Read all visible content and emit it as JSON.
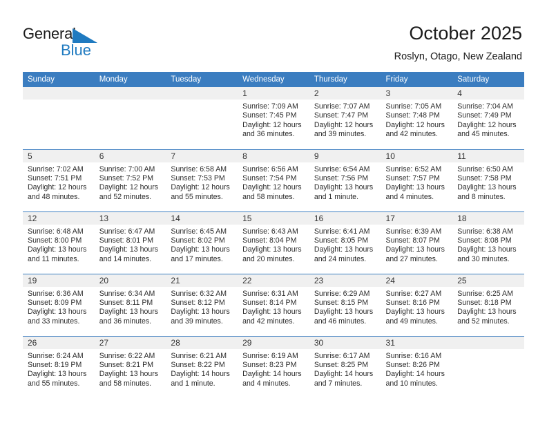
{
  "brand": {
    "name_part1": "General",
    "name_part2": "Blue",
    "accent_color": "#1f7ac0"
  },
  "header": {
    "title": "October 2025",
    "subtitle": "Roslyn, Otago, New Zealand"
  },
  "calendar": {
    "header_color": "#3b7dc0",
    "daynum_band_color": "#f0f0f0",
    "weekday_headers": [
      "Sunday",
      "Monday",
      "Tuesday",
      "Wednesday",
      "Thursday",
      "Friday",
      "Saturday"
    ],
    "labels": {
      "sunrise": "Sunrise:",
      "sunset": "Sunset:",
      "daylight": "Daylight:"
    },
    "weeks": [
      [
        {
          "day": "",
          "empty": true
        },
        {
          "day": "",
          "empty": true
        },
        {
          "day": "",
          "empty": true
        },
        {
          "day": "1",
          "sunrise": "Sunrise: 7:09 AM",
          "sunset": "Sunset: 7:45 PM",
          "daylight": "Daylight: 12 hours and 36 minutes."
        },
        {
          "day": "2",
          "sunrise": "Sunrise: 7:07 AM",
          "sunset": "Sunset: 7:47 PM",
          "daylight": "Daylight: 12 hours and 39 minutes."
        },
        {
          "day": "3",
          "sunrise": "Sunrise: 7:05 AM",
          "sunset": "Sunset: 7:48 PM",
          "daylight": "Daylight: 12 hours and 42 minutes."
        },
        {
          "day": "4",
          "sunrise": "Sunrise: 7:04 AM",
          "sunset": "Sunset: 7:49 PM",
          "daylight": "Daylight: 12 hours and 45 minutes."
        }
      ],
      [
        {
          "day": "5",
          "sunrise": "Sunrise: 7:02 AM",
          "sunset": "Sunset: 7:51 PM",
          "daylight": "Daylight: 12 hours and 48 minutes."
        },
        {
          "day": "6",
          "sunrise": "Sunrise: 7:00 AM",
          "sunset": "Sunset: 7:52 PM",
          "daylight": "Daylight: 12 hours and 52 minutes."
        },
        {
          "day": "7",
          "sunrise": "Sunrise: 6:58 AM",
          "sunset": "Sunset: 7:53 PM",
          "daylight": "Daylight: 12 hours and 55 minutes."
        },
        {
          "day": "8",
          "sunrise": "Sunrise: 6:56 AM",
          "sunset": "Sunset: 7:54 PM",
          "daylight": "Daylight: 12 hours and 58 minutes."
        },
        {
          "day": "9",
          "sunrise": "Sunrise: 6:54 AM",
          "sunset": "Sunset: 7:56 PM",
          "daylight": "Daylight: 13 hours and 1 minute."
        },
        {
          "day": "10",
          "sunrise": "Sunrise: 6:52 AM",
          "sunset": "Sunset: 7:57 PM",
          "daylight": "Daylight: 13 hours and 4 minutes."
        },
        {
          "day": "11",
          "sunrise": "Sunrise: 6:50 AM",
          "sunset": "Sunset: 7:58 PM",
          "daylight": "Daylight: 13 hours and 8 minutes."
        }
      ],
      [
        {
          "day": "12",
          "sunrise": "Sunrise: 6:48 AM",
          "sunset": "Sunset: 8:00 PM",
          "daylight": "Daylight: 13 hours and 11 minutes."
        },
        {
          "day": "13",
          "sunrise": "Sunrise: 6:47 AM",
          "sunset": "Sunset: 8:01 PM",
          "daylight": "Daylight: 13 hours and 14 minutes."
        },
        {
          "day": "14",
          "sunrise": "Sunrise: 6:45 AM",
          "sunset": "Sunset: 8:02 PM",
          "daylight": "Daylight: 13 hours and 17 minutes."
        },
        {
          "day": "15",
          "sunrise": "Sunrise: 6:43 AM",
          "sunset": "Sunset: 8:04 PM",
          "daylight": "Daylight: 13 hours and 20 minutes."
        },
        {
          "day": "16",
          "sunrise": "Sunrise: 6:41 AM",
          "sunset": "Sunset: 8:05 PM",
          "daylight": "Daylight: 13 hours and 24 minutes."
        },
        {
          "day": "17",
          "sunrise": "Sunrise: 6:39 AM",
          "sunset": "Sunset: 8:07 PM",
          "daylight": "Daylight: 13 hours and 27 minutes."
        },
        {
          "day": "18",
          "sunrise": "Sunrise: 6:38 AM",
          "sunset": "Sunset: 8:08 PM",
          "daylight": "Daylight: 13 hours and 30 minutes."
        }
      ],
      [
        {
          "day": "19",
          "sunrise": "Sunrise: 6:36 AM",
          "sunset": "Sunset: 8:09 PM",
          "daylight": "Daylight: 13 hours and 33 minutes."
        },
        {
          "day": "20",
          "sunrise": "Sunrise: 6:34 AM",
          "sunset": "Sunset: 8:11 PM",
          "daylight": "Daylight: 13 hours and 36 minutes."
        },
        {
          "day": "21",
          "sunrise": "Sunrise: 6:32 AM",
          "sunset": "Sunset: 8:12 PM",
          "daylight": "Daylight: 13 hours and 39 minutes."
        },
        {
          "day": "22",
          "sunrise": "Sunrise: 6:31 AM",
          "sunset": "Sunset: 8:14 PM",
          "daylight": "Daylight: 13 hours and 42 minutes."
        },
        {
          "day": "23",
          "sunrise": "Sunrise: 6:29 AM",
          "sunset": "Sunset: 8:15 PM",
          "daylight": "Daylight: 13 hours and 46 minutes."
        },
        {
          "day": "24",
          "sunrise": "Sunrise: 6:27 AM",
          "sunset": "Sunset: 8:16 PM",
          "daylight": "Daylight: 13 hours and 49 minutes."
        },
        {
          "day": "25",
          "sunrise": "Sunrise: 6:25 AM",
          "sunset": "Sunset: 8:18 PM",
          "daylight": "Daylight: 13 hours and 52 minutes."
        }
      ],
      [
        {
          "day": "26",
          "sunrise": "Sunrise: 6:24 AM",
          "sunset": "Sunset: 8:19 PM",
          "daylight": "Daylight: 13 hours and 55 minutes."
        },
        {
          "day": "27",
          "sunrise": "Sunrise: 6:22 AM",
          "sunset": "Sunset: 8:21 PM",
          "daylight": "Daylight: 13 hours and 58 minutes."
        },
        {
          "day": "28",
          "sunrise": "Sunrise: 6:21 AM",
          "sunset": "Sunset: 8:22 PM",
          "daylight": "Daylight: 14 hours and 1 minute."
        },
        {
          "day": "29",
          "sunrise": "Sunrise: 6:19 AM",
          "sunset": "Sunset: 8:23 PM",
          "daylight": "Daylight: 14 hours and 4 minutes."
        },
        {
          "day": "30",
          "sunrise": "Sunrise: 6:17 AM",
          "sunset": "Sunset: 8:25 PM",
          "daylight": "Daylight: 14 hours and 7 minutes."
        },
        {
          "day": "31",
          "sunrise": "Sunrise: 6:16 AM",
          "sunset": "Sunset: 8:26 PM",
          "daylight": "Daylight: 14 hours and 10 minutes."
        },
        {
          "day": "",
          "empty": true
        }
      ]
    ]
  }
}
